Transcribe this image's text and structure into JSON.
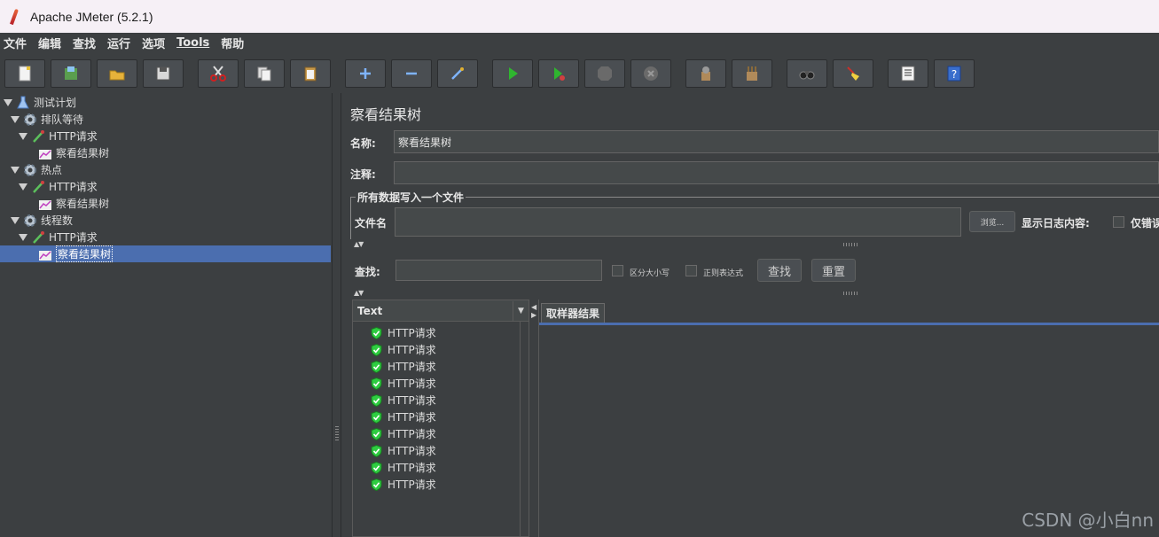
{
  "window": {
    "title": "Apache JMeter (5.2.1)"
  },
  "menu": [
    "文件",
    "编辑",
    "查找",
    "运行",
    "选项",
    "Tools",
    "帮助"
  ],
  "toolbar": {
    "buttons": [
      "new-icon",
      "templates-icon",
      "open-icon",
      "save-icon",
      "cut-icon",
      "copy-icon",
      "paste-icon",
      "expand-icon",
      "collapse-icon",
      "toggle-icon",
      "start-icon",
      "start-no-pause-icon",
      "stop-icon",
      "shutdown-icon",
      "clear-icon",
      "clear-all-icon",
      "search-icon",
      "reset-search-icon",
      "function-helper-icon",
      "help-icon"
    ]
  },
  "tree": {
    "items": [
      {
        "label": "测试计划",
        "icon": "test-plan-icon"
      },
      {
        "label": "排队等待",
        "icon": "thread-group-icon"
      },
      {
        "label": "HTTP请求",
        "icon": "sampler-icon"
      },
      {
        "label": "察看结果树",
        "icon": "listener-icon"
      },
      {
        "label": "热点",
        "icon": "thread-group-icon"
      },
      {
        "label": "HTTP请求",
        "icon": "sampler-icon"
      },
      {
        "label": "察看结果树",
        "icon": "listener-icon"
      },
      {
        "label": "线程数",
        "icon": "thread-group-icon"
      },
      {
        "label": "HTTP请求",
        "icon": "sampler-icon"
      },
      {
        "label": "察看结果树",
        "icon": "listener-icon",
        "selected": true
      }
    ]
  },
  "panel": {
    "title": "察看结果树",
    "name_label": "名称:",
    "name_value": "察看结果树",
    "comment_label": "注释:",
    "comment_value": "",
    "file_legend": "所有数据写入一个文件",
    "filename_label": "文件名",
    "filename_value": "",
    "browse_label": "浏览...",
    "log_label": "显示日志内容:",
    "errors_only_label": "仅错误",
    "search_label": "查找:",
    "search_value": "",
    "case_label": "区分大小写",
    "regex_label": "正则表达式",
    "search_button": "查找",
    "reset_button": "重置"
  },
  "results": {
    "column": "Text",
    "items": [
      "HTTP请求",
      "HTTP请求",
      "HTTP请求",
      "HTTP请求",
      "HTTP请求",
      "HTTP请求",
      "HTTP请求",
      "HTTP请求",
      "HTTP请求",
      "HTTP请求"
    ],
    "tab_label": "取样器结果"
  },
  "watermark": "CSDN @小白nn",
  "colors": {
    "background": "#3c3f41",
    "selection": "#4b6eaf",
    "success": "#2ecc40"
  }
}
